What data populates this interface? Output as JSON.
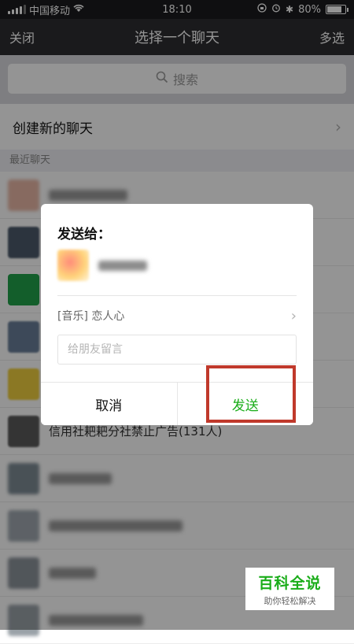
{
  "status_bar": {
    "carrier": "中国移动",
    "time": "18:10",
    "battery": "80%",
    "battery_level": 0.8
  },
  "nav": {
    "close_label": "关闭",
    "title": "选择一个聊天",
    "multi_select_label": "多选"
  },
  "search": {
    "placeholder": "搜索"
  },
  "create_chat": {
    "label": "创建新的聊天"
  },
  "recent_section": {
    "title": "最近聊天"
  },
  "chat_rows": [
    {
      "name": "",
      "avatar_color": "#e8b7a6"
    },
    {
      "name": "",
      "avatar_color": "#4c5a6b"
    },
    {
      "name": "",
      "avatar_color": "#22a24a"
    },
    {
      "name": "",
      "avatar_color": "#6a7f99"
    },
    {
      "name": "",
      "avatar_color": "#f0cf3f"
    },
    {
      "name": "信用社耙耙分社禁止广告(131人)",
      "avatar_color": "#5b5b5b"
    },
    {
      "name": "",
      "avatar_color": "#7e8c95"
    },
    {
      "name": "",
      "avatar_color": "#a0a8b0"
    },
    {
      "name": "",
      "avatar_color": "#8c949b"
    },
    {
      "name": "",
      "avatar_color": "#9aa2a8"
    }
  ],
  "dialog": {
    "title": "发送给：",
    "share_item": "[音乐] 恋人心",
    "message_placeholder": "给朋友留言",
    "cancel_label": "取消",
    "send_label": "发送"
  },
  "watermark": {
    "title": "百科全说",
    "subtitle": "助你轻松解决"
  },
  "colors": {
    "accent_green": "#1aad19",
    "highlight_red": "#c0392b",
    "nav_bg": "#2e2e31"
  }
}
